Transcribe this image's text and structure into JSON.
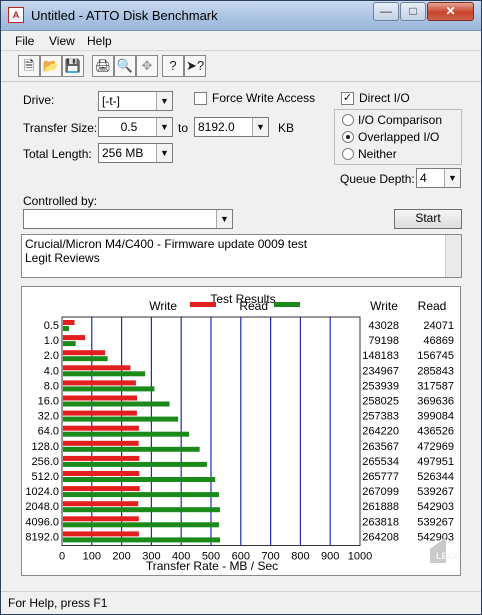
{
  "window": {
    "title": "Untitled - ATTO Disk Benchmark",
    "app_icon_text": "A"
  },
  "menu": [
    "File",
    "View",
    "Help"
  ],
  "toolbar": [
    "new-file",
    "open-folder",
    "save",
    "print",
    "print-preview",
    "move",
    "help",
    "context-help"
  ],
  "form": {
    "drive_label": "Drive:",
    "drive_value": "[-t-]",
    "force_write_label": "Force Write Access",
    "force_write_checked": false,
    "direct_io_label": "Direct I/O",
    "direct_io_checked": true,
    "transfer_size_label": "Transfer Size:",
    "transfer_from": "0.5",
    "to_label": "to",
    "transfer_to": "8192.0",
    "kb_label": "KB",
    "total_length_label": "Total Length:",
    "total_length_value": "256 MB",
    "io_options": [
      {
        "label": "I/O Comparison",
        "selected": false
      },
      {
        "label": "Overlapped I/O",
        "selected": true
      },
      {
        "label": "Neither",
        "selected": false
      }
    ],
    "queue_depth_label": "Queue Depth:",
    "queue_depth_value": "4",
    "controlled_by_label": "Controlled by:",
    "controlled_by_value": "",
    "start_label": "Start",
    "description_lines": [
      "Crucial/Micron M4/C400 - Firmware update 0009 test",
      "Legit Reviews"
    ]
  },
  "test_results_title": "Test Results",
  "legend": {
    "write_label": "Write",
    "read_label": "Read"
  },
  "table_headers": {
    "write": "Write",
    "read": "Read"
  },
  "colors": {
    "write": "#e31e1e",
    "read": "#1b8a1b",
    "grid": "#1c2fb0"
  },
  "chart_data": {
    "type": "bar",
    "orientation": "horizontal",
    "title": "Test Results",
    "xlabel": "Transfer Rate - MB / Sec",
    "xlim": [
      0,
      1000
    ],
    "x_ticks": [
      0,
      100,
      200,
      300,
      400,
      500,
      600,
      700,
      800,
      900,
      1000
    ],
    "categories": [
      "0.5",
      "1.0",
      "2.0",
      "4.0",
      "8.0",
      "16.0",
      "32.0",
      "64.0",
      "128.0",
      "256.0",
      "512.0",
      "1024.0",
      "2048.0",
      "4096.0",
      "8192.0"
    ],
    "series": [
      {
        "name": "Write",
        "values": [
          43028,
          79198,
          148183,
          234967,
          253939,
          258025,
          257383,
          264220,
          263567,
          265534,
          265777,
          267099,
          261888,
          263818,
          264208
        ]
      },
      {
        "name": "Read",
        "values": [
          24071,
          46869,
          156745,
          285843,
          317587,
          369636,
          399084,
          436526,
          472969,
          497951,
          526344,
          539267,
          542903,
          539267,
          542903
        ]
      }
    ]
  },
  "status": "For Help, press F1",
  "watermark": "LEGIT"
}
